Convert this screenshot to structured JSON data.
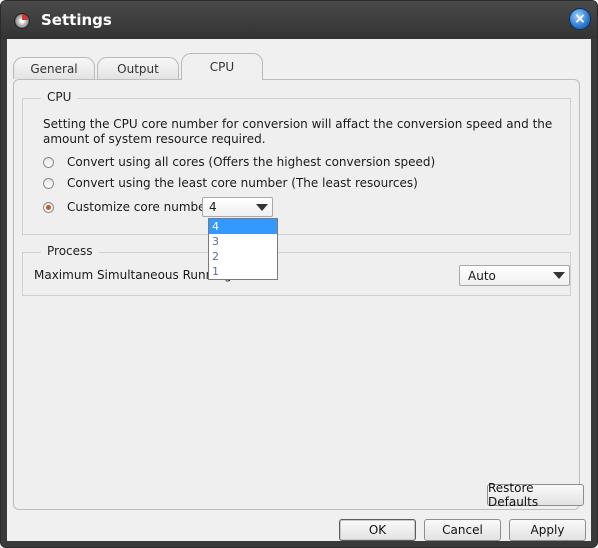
{
  "window": {
    "title": "Settings",
    "close_glyph": "×",
    "icons": {
      "app": "disc-app-icon",
      "close": "close-icon"
    }
  },
  "tabs": [
    {
      "label": "General"
    },
    {
      "label": "Output"
    },
    {
      "label": "CPU",
      "active": true
    }
  ],
  "cpu_group": {
    "legend": "CPU",
    "description": "Setting the CPU core number for conversion will affact the conversion  speed and the amount of system resource required.",
    "options": [
      {
        "label": "Convert using all cores (Offers the highest conversion speed)",
        "checked": false
      },
      {
        "label": "Convert using the least core number (The least resources)",
        "checked": false
      },
      {
        "label": "Customize core number",
        "checked": true
      }
    ],
    "core_select": {
      "value": "4",
      "options": [
        "4",
        "3",
        "2",
        "1"
      ],
      "selected_index": 0
    }
  },
  "process_group": {
    "legend": "Process",
    "label": "Maximum Simultaneous Running",
    "select_value": "Auto"
  },
  "buttons": {
    "restore_defaults": "Restore Defaults",
    "ok": "OK",
    "cancel": "Cancel",
    "apply": "Apply"
  },
  "colors": {
    "accent_selection": "#3399ff",
    "radio_checked": "#c4592a",
    "title_bar": "#3a3a3a"
  }
}
